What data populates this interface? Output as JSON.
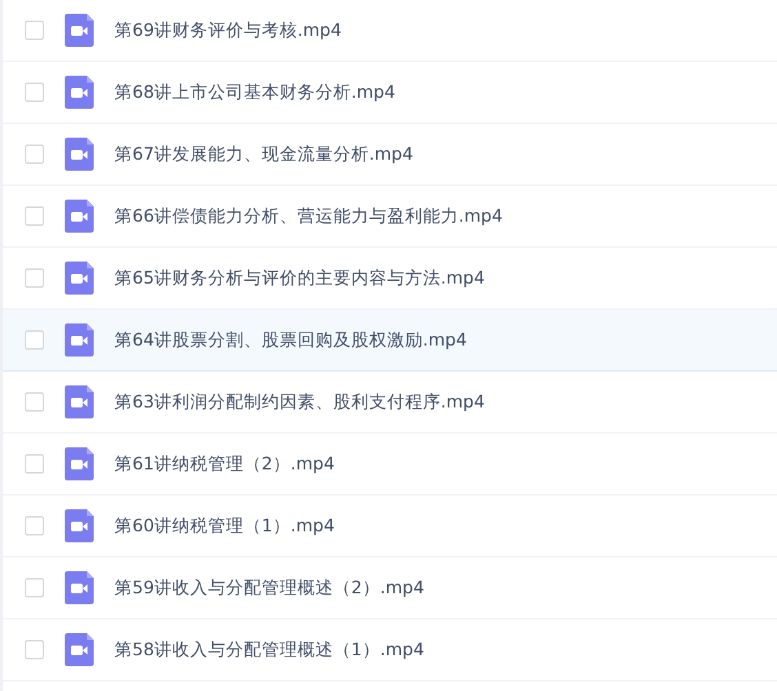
{
  "files": [
    {
      "name": "第69讲财务评价与考核.mp4",
      "checked": false,
      "hovered": false
    },
    {
      "name": "第68讲上市公司基本财务分析.mp4",
      "checked": false,
      "hovered": false
    },
    {
      "name": "第67讲发展能力、现金流量分析.mp4",
      "checked": false,
      "hovered": false
    },
    {
      "name": "第66讲偿债能力分析、营运能力与盈利能力.mp4",
      "checked": false,
      "hovered": false
    },
    {
      "name": "第65讲财务分析与评价的主要内容与方法.mp4",
      "checked": false,
      "hovered": false
    },
    {
      "name": "第64讲股票分割、股票回购及股权激励.mp4",
      "checked": false,
      "hovered": true
    },
    {
      "name": "第63讲利润分配制约因素、股利支付程序.mp4",
      "checked": false,
      "hovered": false
    },
    {
      "name": "第61讲纳税管理（2）.mp4",
      "checked": false,
      "hovered": false
    },
    {
      "name": "第60讲纳税管理（1）.mp4",
      "checked": false,
      "hovered": false
    },
    {
      "name": "第59讲收入与分配管理概述（2）.mp4",
      "checked": false,
      "hovered": false
    },
    {
      "name": "第58讲收入与分配管理概述（1）.mp4",
      "checked": false,
      "hovered": false
    }
  ]
}
